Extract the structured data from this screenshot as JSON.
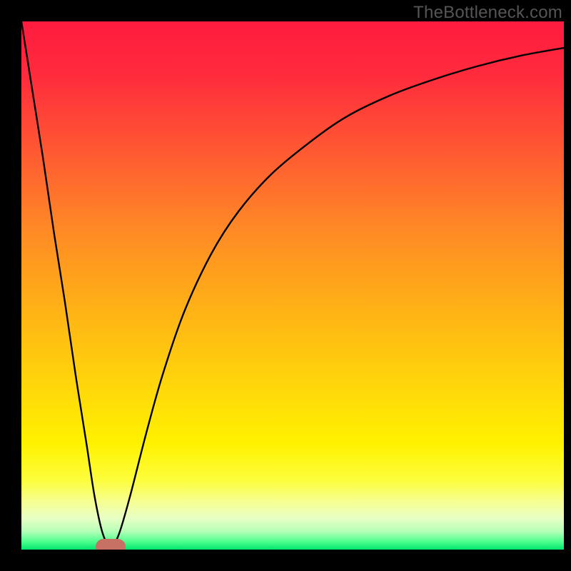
{
  "watermark": "TheBottleneck.com",
  "gradient": {
    "stops": [
      {
        "offset": 0.0,
        "color": "#ff1b3e"
      },
      {
        "offset": 0.1,
        "color": "#ff2b3d"
      },
      {
        "offset": 0.25,
        "color": "#ff5a32"
      },
      {
        "offset": 0.4,
        "color": "#ff8b25"
      },
      {
        "offset": 0.55,
        "color": "#ffb315"
      },
      {
        "offset": 0.7,
        "color": "#ffd90a"
      },
      {
        "offset": 0.8,
        "color": "#fff200"
      },
      {
        "offset": 0.87,
        "color": "#fdfe3e"
      },
      {
        "offset": 0.91,
        "color": "#f6ff94"
      },
      {
        "offset": 0.94,
        "color": "#e8ffc3"
      },
      {
        "offset": 0.965,
        "color": "#b6ffb8"
      },
      {
        "offset": 0.985,
        "color": "#4eff8e"
      },
      {
        "offset": 1.0,
        "color": "#00e56e"
      }
    ]
  },
  "chart_data": {
    "type": "line",
    "title": "",
    "xlabel": "",
    "ylabel": "",
    "xlim": [
      0,
      100
    ],
    "ylim": [
      0,
      100
    ],
    "grid": false,
    "series": [
      {
        "name": "curve",
        "x": [
          0,
          2,
          4,
          6,
          8,
          10,
          12,
          13.5,
          15,
          16.5,
          18,
          20,
          23,
          26,
          30,
          35,
          40,
          46,
          53,
          60,
          68,
          76,
          84,
          92,
          100
        ],
        "y": [
          100,
          87,
          74,
          60,
          47,
          33,
          20,
          10,
          3,
          0.5,
          3,
          10,
          22,
          33,
          45,
          56,
          64,
          71,
          77,
          82,
          86,
          89,
          91.5,
          93.5,
          95
        ]
      }
    ],
    "marker": {
      "x": 16.5,
      "y": 0.5,
      "color": "#c77064"
    }
  }
}
